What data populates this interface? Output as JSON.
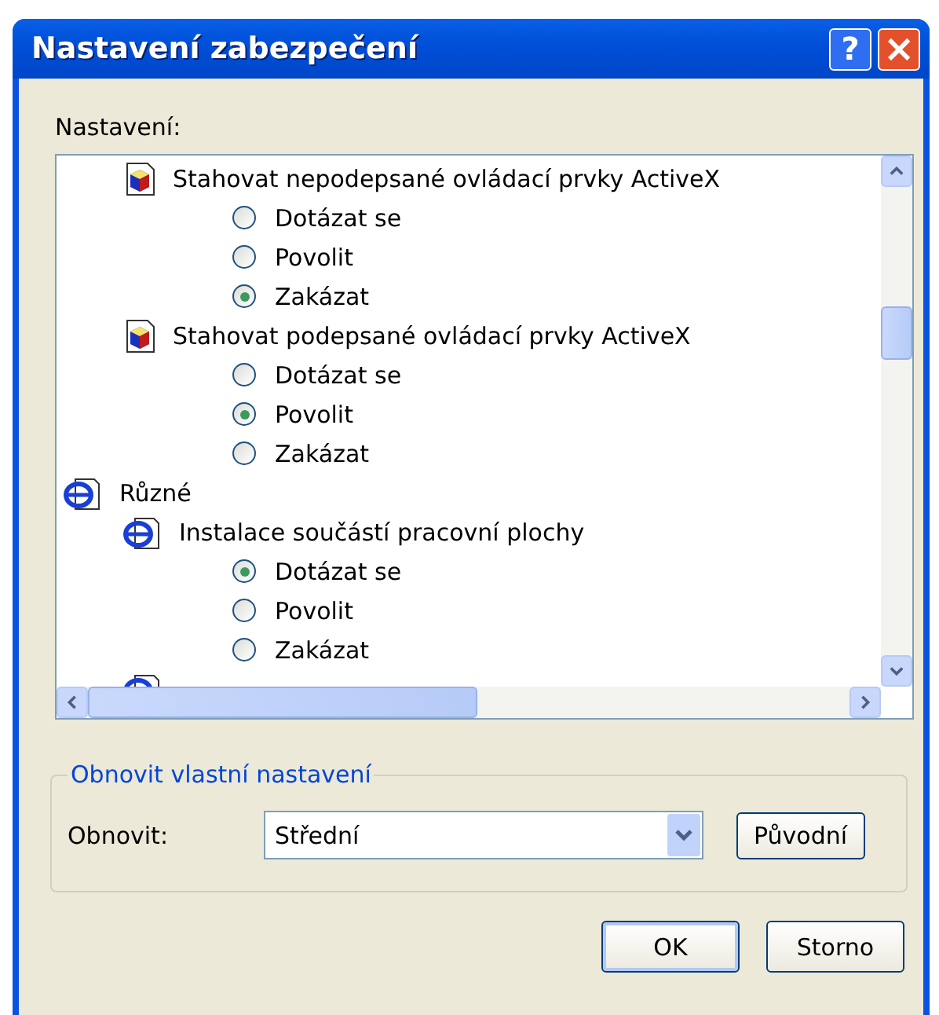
{
  "window": {
    "title": "Nastavení zabezpečení",
    "help_button": "?",
    "close_button": "×"
  },
  "settings_label": "Nastavení:",
  "tree": [
    {
      "kind": "category",
      "children": [
        {
          "kind": "control-setting",
          "label": "Stahovat nepodepsané ovládací prvky ActiveX",
          "children": [
            {
              "kind": "option",
              "label": "Dotázat se",
              "selected": false
            },
            {
              "kind": "option",
              "label": "Povolit",
              "selected": false
            },
            {
              "kind": "option",
              "label": "Zakázat",
              "selected": true
            }
          ]
        },
        {
          "kind": "control-setting",
          "label": "Stahovat podepsané ovládací prvky ActiveX",
          "children": [
            {
              "kind": "option",
              "label": "Dotázat se",
              "selected": false
            },
            {
              "kind": "option",
              "label": "Povolit",
              "selected": true
            },
            {
              "kind": "option",
              "label": "Zakázat",
              "selected": false
            }
          ]
        }
      ]
    },
    {
      "kind": "category",
      "label": "Různé",
      "children": [
        {
          "kind": "general-setting",
          "label": "Instalace součástí pracovní plochy",
          "children": [
            {
              "kind": "option",
              "label": "Dotázat se",
              "selected": true
            },
            {
              "kind": "option",
              "label": "Povolit",
              "selected": false
            },
            {
              "kind": "option",
              "label": "Zakázat",
              "selected": false
            }
          ]
        },
        {
          "kind": "general-setting"
        }
      ]
    }
  ],
  "reset_group": {
    "legend": "Obnovit vlastní nastavení",
    "label": "Obnovit:",
    "value": "Střední",
    "button": "Původní"
  },
  "buttons": [
    "OK",
    "Storno"
  ]
}
